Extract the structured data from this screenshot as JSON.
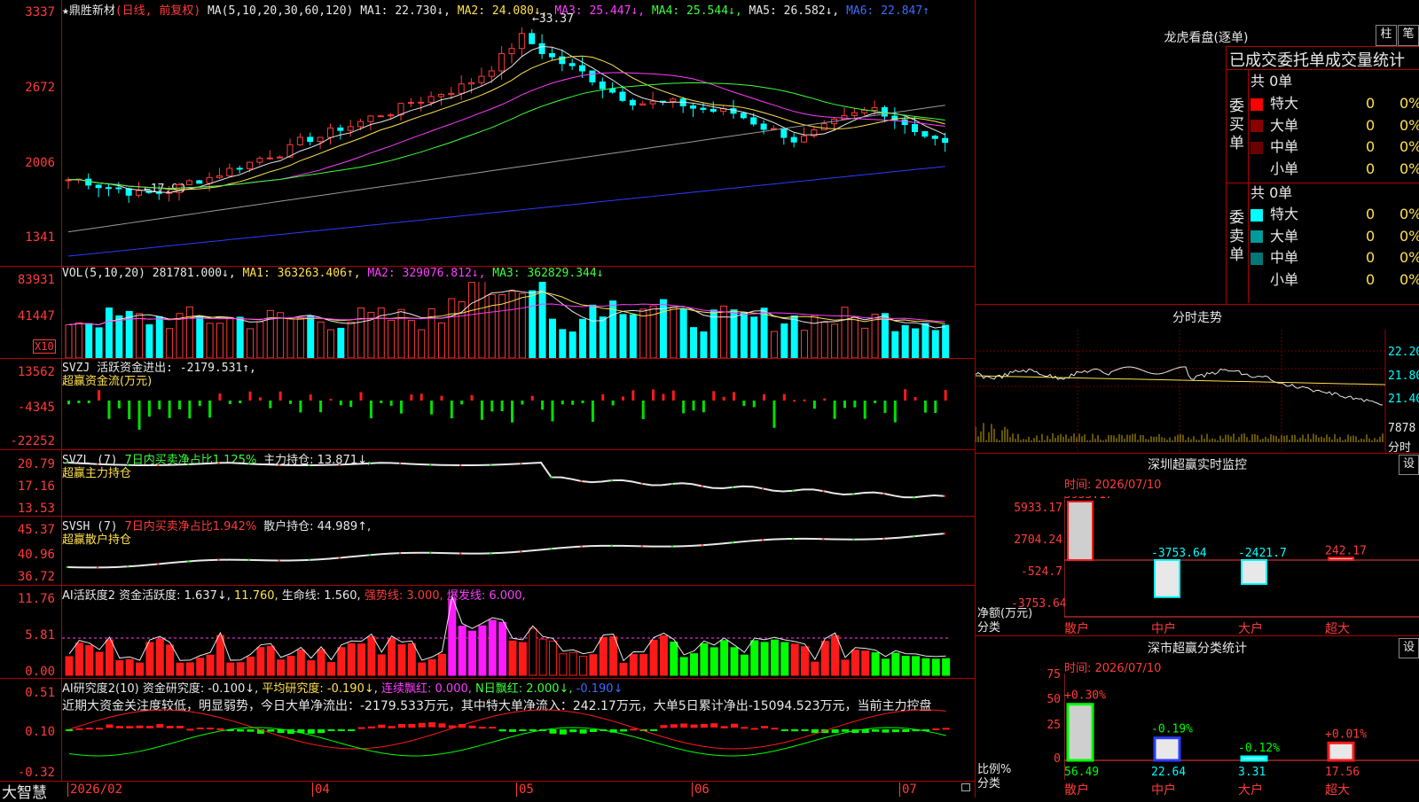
{
  "main": {
    "title_star": "★",
    "stock_name": "鼎胜新材",
    "mode": "(日线, 前复权)",
    "ma_spec": "MA(5,10,20,30,60,120)",
    "ma1": "MA1: 22.730↓,",
    "ma2": "MA2: 24.080↓,",
    "ma3": "MA3: 25.447↓,",
    "ma4": "MA4: 25.544↓,",
    "ma5": "MA5: 26.582↓,",
    "ma6": "MA6: 22.847↑",
    "y_labels": [
      "3337",
      "2672",
      "2006",
      "1341"
    ],
    "high_label": "←33.37",
    "low_label": "←17.90"
  },
  "vol": {
    "header_spec": "VOL(5,10,20)",
    "value": "281781.000↓,",
    "ma1": "MA1: 363263.406↑,",
    "ma2": "MA2: 329076.812↓,",
    "ma3": "MA3: 362829.344↓",
    "y_labels": [
      "83931",
      "41447"
    ],
    "unit": "X10"
  },
  "svzj": {
    "line1": "SVZJ  活跃资金进出: -2179.531↑,",
    "line2": "超赢资金流(万元)",
    "y_labels": [
      "13562",
      "-4345",
      "-22252"
    ]
  },
  "svzl": {
    "prefix": "SVZL (7)",
    "ratio": "7日内买卖净占比1.125%",
    "holding": "主力持仓: 13.871↓,",
    "line2": "超赢主力持仓",
    "y_labels": [
      "20.79",
      "17.16",
      "13.53"
    ]
  },
  "svsh": {
    "prefix": "SVSH (7)",
    "ratio": "7日内买卖净占比1.942%",
    "holding": "散户持仓: 44.989↑,",
    "line2": "超赢散户持仓",
    "y_labels": [
      "45.37",
      "40.96",
      "36.72"
    ]
  },
  "ai1": {
    "prefix": "AI活跃度2 资金活跃度: 1.637↓,",
    "v2": "11.760,",
    "life": "生命线: 1.560,",
    "strong": "强势线: 3.000,",
    "burst": "爆发线: 6.000,",
    "y_labels": [
      "11.76",
      "5.81",
      "0.00"
    ]
  },
  "ai2": {
    "prefix": "AI研究度2(10)",
    "research": "资金研究度: -0.100↓,",
    "avg": "平均研究度: -0.190↓,",
    "lianxu": "连续飘红: 0.000,",
    "nday": "N日飘红: 2.000↓,",
    "last": "-0.190↓",
    "comment": "近期大资金关注度较低，明显弱势，今日大单净流出：-2179.533万元，其中特大单净流入：242.17万元，大单5日累计净出-15094.523万元，当前主力控盘",
    "y_labels": [
      "0.51",
      "0.10",
      "-0.32"
    ]
  },
  "xaxis": {
    "logo": "大智慧",
    "labels": [
      "2026/02",
      "04",
      "05",
      "06",
      "07"
    ]
  },
  "lhb": {
    "title": "龙虎看盘(逐单)",
    "btn1": "柱",
    "btn2": "笔",
    "subtitle": "已成交委托单成交量统计",
    "buy_label": "委买单",
    "sell_label": "委卖单",
    "buy_total": "共 0单",
    "sell_total": "共 0单",
    "buy_rows": [
      {
        "name": "特大",
        "count": "0",
        "pct": "0%",
        "color": "#ff0000"
      },
      {
        "name": "大单",
        "count": "0",
        "pct": "0%",
        "color": "#8b0000"
      },
      {
        "name": "中单",
        "count": "0",
        "pct": "0%",
        "color": "#6b0000"
      },
      {
        "name": "小单",
        "count": "0",
        "pct": "0%",
        "color": "#000000"
      }
    ],
    "sell_rows": [
      {
        "name": "特大",
        "count": "0",
        "pct": "0%",
        "color": "#00ffff"
      },
      {
        "name": "大单",
        "count": "0",
        "pct": "0%",
        "color": "#009a9a"
      },
      {
        "name": "中单",
        "count": "0",
        "pct": "0%",
        "color": "#007878"
      },
      {
        "name": "小单",
        "count": "0",
        "pct": "0%",
        "color": "#000000"
      }
    ]
  },
  "intraday": {
    "title": "分时走势",
    "y_labels": [
      "22.20",
      "21.80",
      "21.40"
    ],
    "vol_label": "7878",
    "unit": "分时"
  },
  "sz_monitor": {
    "title": "深圳超赢实时监控",
    "btn": "设",
    "date": "时间: 2026/07/10",
    "y_labels": [
      "5933.17",
      "2704.24",
      "-524.7",
      "-3753.64"
    ],
    "y_unit": "净额(万元)",
    "x_unit": "分类",
    "bars": [
      {
        "name": "散户",
        "value": 5933.17,
        "label": "5933.17"
      },
      {
        "name": "中户",
        "value": -3753.64,
        "label": "-3753.64"
      },
      {
        "name": "大户",
        "value": -2421.7,
        "label": "-2421.7"
      },
      {
        "name": "超大",
        "value": 242.17,
        "label": "242.17"
      }
    ]
  },
  "sz_class": {
    "title": "深市超赢分类统计",
    "btn": "设",
    "date": "时间: 2026/07/10",
    "y_labels": [
      "75",
      "50",
      "25",
      "0"
    ],
    "y_unit": "比例%",
    "x_unit": "分类",
    "bars": [
      {
        "name": "散户",
        "value": 56.49,
        "change": "+0.30%",
        "label": "56.49"
      },
      {
        "name": "中户",
        "value": 22.64,
        "change": "-0.19%",
        "label": "22.64"
      },
      {
        "name": "大户",
        "value": 3.31,
        "change": "-0.12%",
        "label": "3.31"
      },
      {
        "name": "超大",
        "value": 17.56,
        "change": "+0.01%",
        "label": "17.56"
      }
    ]
  }
}
